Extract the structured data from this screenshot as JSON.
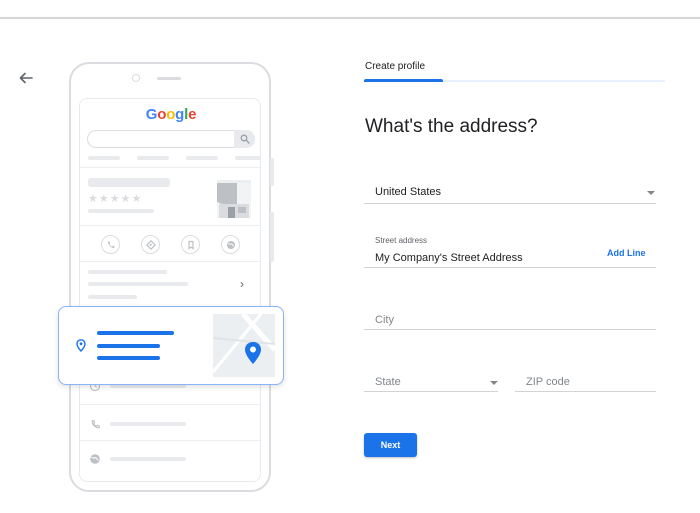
{
  "illustration": {
    "logo_letters": [
      {
        "char": "G",
        "color": "#4285f4"
      },
      {
        "char": "o",
        "color": "#ea4335"
      },
      {
        "char": "o",
        "color": "#fbbc05"
      },
      {
        "char": "g",
        "color": "#4285f4"
      },
      {
        "char": "l",
        "color": "#34a853"
      },
      {
        "char": "e",
        "color": "#ea4335"
      }
    ],
    "rating_stars": "★★★★★",
    "chevron": "›"
  },
  "form": {
    "tab_label": "Create profile",
    "heading": "What's the address?",
    "country": {
      "value": "United States"
    },
    "street": {
      "label": "Street address",
      "value": "My Company's Street Address",
      "add_line": "Add Line"
    },
    "city": {
      "placeholder": "City"
    },
    "state": {
      "placeholder": "State"
    },
    "zip": {
      "placeholder": "ZIP code"
    },
    "next_label": "Next"
  },
  "icons": {
    "back": "arrow-left-icon",
    "search": "search-icon",
    "phone": "phone-icon",
    "directions": "directions-icon",
    "save": "bookmark-icon",
    "website": "globe-icon",
    "location_pin": "location-pin-icon",
    "clock": "clock-icon"
  },
  "colors": {
    "accent": "#1a73e8",
    "map_pin": "#1a73e8",
    "tab_track": "#e8f0fe"
  }
}
